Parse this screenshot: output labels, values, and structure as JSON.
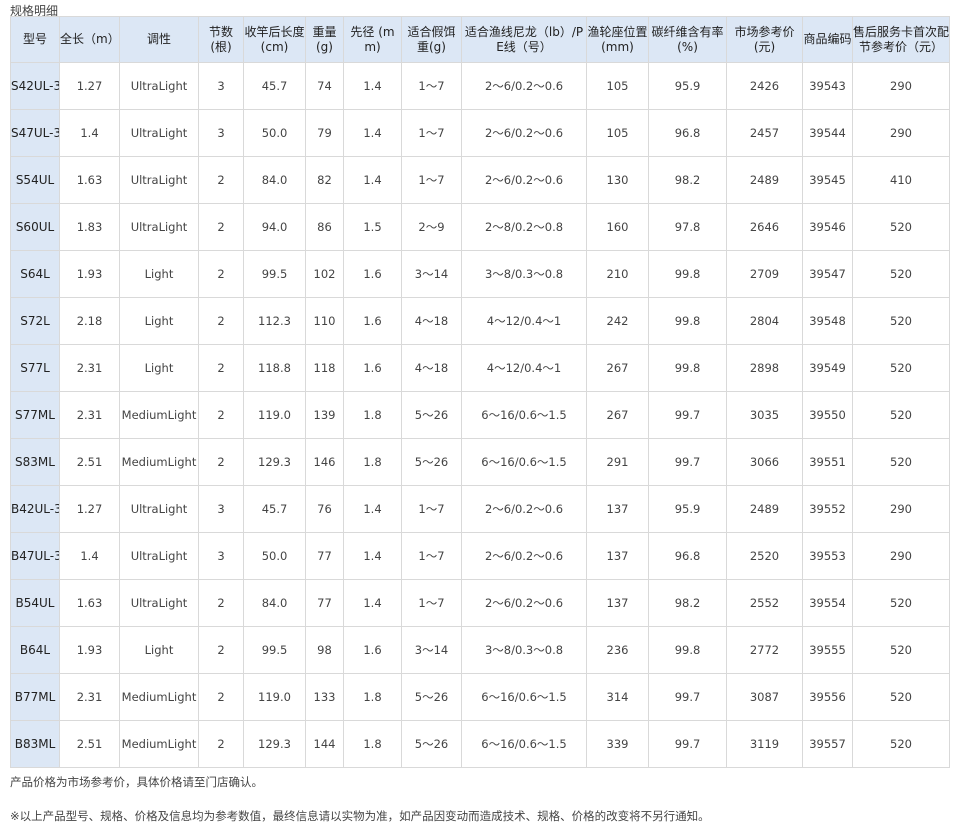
{
  "section_title": "规格明细",
  "headers": [
    "型号",
    "全长（m）",
    "调性",
    "节数(根)",
    "收竿后长度(cm)",
    "重量(g)",
    "先径 (mm)",
    "适合假饵重(g)",
    "适合渔线尼龙（lb）/PE线（号）",
    "渔轮座位置(mm)",
    "碳纤维含有率(%)",
    "市场参考价(元)",
    "商品编码",
    "售后服务卡首次配节参考价（元）"
  ],
  "rows": [
    [
      "S42UL-3",
      "1.27",
      "UltraLight",
      "3",
      "45.7",
      "74",
      "1.4",
      "1～7",
      "2～6/0.2～0.6",
      "105",
      "95.9",
      "2426",
      "39543",
      "290"
    ],
    [
      "S47UL-3",
      "1.4",
      "UltraLight",
      "3",
      "50.0",
      "79",
      "1.4",
      "1～7",
      "2～6/0.2～0.6",
      "105",
      "96.8",
      "2457",
      "39544",
      "290"
    ],
    [
      "S54UL",
      "1.63",
      "UltraLight",
      "2",
      "84.0",
      "82",
      "1.4",
      "1～7",
      "2～6/0.2～0.6",
      "130",
      "98.2",
      "2489",
      "39545",
      "410"
    ],
    [
      "S60UL",
      "1.83",
      "UltraLight",
      "2",
      "94.0",
      "86",
      "1.5",
      "2～9",
      "2～8/0.2～0.8",
      "160",
      "97.8",
      "2646",
      "39546",
      "520"
    ],
    [
      "S64L",
      "1.93",
      "Light",
      "2",
      "99.5",
      "102",
      "1.6",
      "3～14",
      "3～8/0.3～0.8",
      "210",
      "99.8",
      "2709",
      "39547",
      "520"
    ],
    [
      "S72L",
      "2.18",
      "Light",
      "2",
      "112.3",
      "110",
      "1.6",
      "4～18",
      "4～12/0.4～1",
      "242",
      "99.8",
      "2804",
      "39548",
      "520"
    ],
    [
      "S77L",
      "2.31",
      "Light",
      "2",
      "118.8",
      "118",
      "1.6",
      "4～18",
      "4～12/0.4～1",
      "267",
      "99.8",
      "2898",
      "39549",
      "520"
    ],
    [
      "S77ML",
      "2.31",
      "MediumLight",
      "2",
      "119.0",
      "139",
      "1.8",
      "5～26",
      "6～16/0.6～1.5",
      "267",
      "99.7",
      "3035",
      "39550",
      "520"
    ],
    [
      "S83ML",
      "2.51",
      "MediumLight",
      "2",
      "129.3",
      "146",
      "1.8",
      "5～26",
      "6～16/0.6～1.5",
      "291",
      "99.7",
      "3066",
      "39551",
      "520"
    ],
    [
      "B42UL-3",
      "1.27",
      "UltraLight",
      "3",
      "45.7",
      "76",
      "1.4",
      "1～7",
      "2～6/0.2～0.6",
      "137",
      "95.9",
      "2489",
      "39552",
      "290"
    ],
    [
      "B47UL-3",
      "1.4",
      "UltraLight",
      "3",
      "50.0",
      "77",
      "1.4",
      "1～7",
      "2～6/0.2～0.6",
      "137",
      "96.8",
      "2520",
      "39553",
      "290"
    ],
    [
      "B54UL",
      "1.63",
      "UltraLight",
      "2",
      "84.0",
      "77",
      "1.4",
      "1～7",
      "2～6/0.2～0.6",
      "137",
      "98.2",
      "2552",
      "39554",
      "520"
    ],
    [
      "B64L",
      "1.93",
      "Light",
      "2",
      "99.5",
      "98",
      "1.6",
      "3～14",
      "3～8/0.3～0.8",
      "236",
      "99.8",
      "2772",
      "39555",
      "520"
    ],
    [
      "B77ML",
      "2.31",
      "MediumLight",
      "2",
      "119.0",
      "133",
      "1.8",
      "5～26",
      "6～16/0.6～1.5",
      "314",
      "99.7",
      "3087",
      "39556",
      "520"
    ],
    [
      "B83ML",
      "2.51",
      "MediumLight",
      "2",
      "129.3",
      "144",
      "1.8",
      "5～26",
      "6～16/0.6～1.5",
      "339",
      "99.7",
      "3119",
      "39557",
      "520"
    ]
  ],
  "notes": {
    "price_note": "产品价格为市场参考价，具体价格请至门店确认。",
    "disclaimer": "※以上产品型号、规格、价格及信息均为参考数值，最终信息请以实物为准，如产品因变动而造成技术、规格、价格的改变将不另行通知。"
  },
  "colors": {
    "header_bg": "#dce7f5",
    "border": "#d9d9d9",
    "text": "#444444"
  }
}
